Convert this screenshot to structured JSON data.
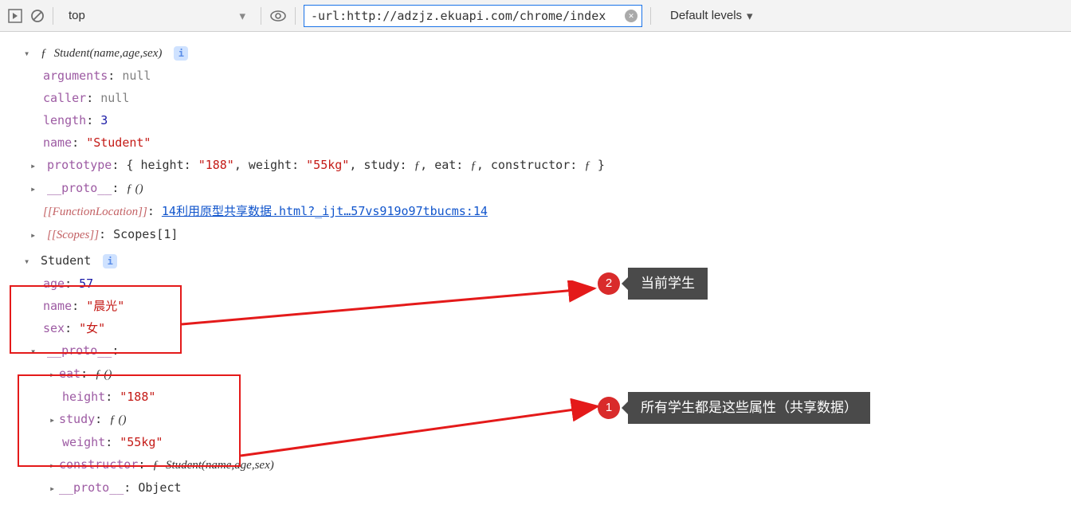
{
  "toolbar": {
    "context": "top",
    "filter_value": "-url:http://adzjz.ekuapi.com/chrome/index",
    "levels_label": "Default levels"
  },
  "fn_header": {
    "sym": "ƒ",
    "signature": "Student(name,age,sex)"
  },
  "fn_props": {
    "arguments": {
      "key": "arguments",
      "val": "null"
    },
    "caller": {
      "key": "caller",
      "val": "null"
    },
    "length": {
      "key": "length",
      "val": "3"
    },
    "name": {
      "key": "name",
      "val": "\"Student\""
    },
    "prototype": {
      "key": "prototype",
      "brace_open": "{",
      "height_k": "height:",
      "height_v": "\"188\"",
      "weight_k": "weight:",
      "weight_v": "\"55kg\"",
      "study_k": "study:",
      "study_v": "ƒ",
      "eat_k": "eat:",
      "eat_v": "ƒ",
      "constr_k": "constructor:",
      "constr_v": "ƒ",
      "brace_close": "}"
    },
    "proto": {
      "key": "__proto__",
      "val": "ƒ ()"
    },
    "fnloc": {
      "key": "[[FunctionLocation]]",
      "val": "14利用原型共享数据.html?_ijt…57vs919o97tbucms:14"
    },
    "scopes": {
      "key": "[[Scopes]]",
      "val": "Scopes[1]"
    }
  },
  "inst_header": "Student",
  "inst": {
    "age": {
      "key": "age",
      "val": "57"
    },
    "name": {
      "key": "name",
      "val": "\"晨光\""
    },
    "sex": {
      "key": "sex",
      "val": "\"女\""
    },
    "proto_key": "__proto__",
    "eat": {
      "key": "eat",
      "val": "ƒ ()"
    },
    "height": {
      "key": "height",
      "val": "\"188\""
    },
    "study": {
      "key": "study",
      "val": "ƒ ()"
    },
    "weight": {
      "key": "weight",
      "val": "\"55kg\""
    },
    "constr": {
      "key": "constructor",
      "sym": "ƒ",
      "sig": "Student(name,age,sex)"
    },
    "protoproto": {
      "key": "__proto__",
      "val": "Object"
    }
  },
  "annotations": {
    "a2": {
      "num": "2",
      "label": "当前学生"
    },
    "a1": {
      "num": "1",
      "label": "所有学生都是这些属性（共享数据）"
    }
  }
}
